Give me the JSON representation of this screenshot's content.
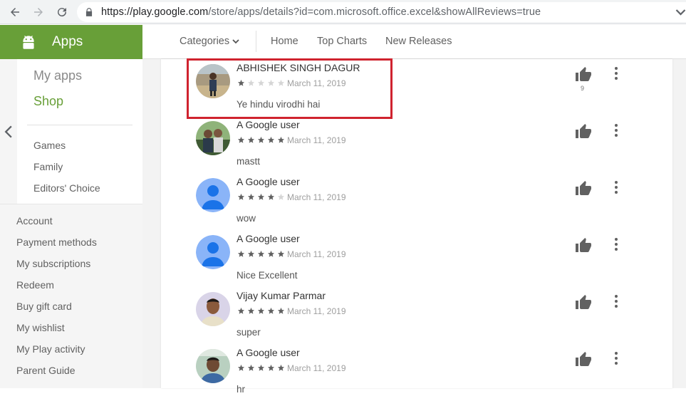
{
  "browser": {
    "url_host": "https://play.google.com",
    "url_path": "/store/apps/details?id=com.microsoft.office.excel&showAllReviews=true"
  },
  "sidebar": {
    "header": "Apps",
    "my_apps": "My apps",
    "shop": "Shop",
    "sub_items": [
      "Games",
      "Family",
      "Editors' Choice"
    ],
    "account_items": [
      "Account",
      "Payment methods",
      "My subscriptions",
      "Redeem",
      "Buy gift card",
      "My wishlist",
      "My Play activity",
      "Parent Guide"
    ]
  },
  "topnav": {
    "categories": "Categories",
    "home": "Home",
    "top_charts": "Top Charts",
    "new_releases": "New Releases"
  },
  "reviews": [
    {
      "author": "ABHISHEK SINGH DAGUR",
      "rating": 1,
      "date": "March 11, 2019",
      "text": "Ye hindu virodhi hai",
      "helpful": "9"
    },
    {
      "author": "A Google user",
      "rating": 5,
      "date": "March 11, 2019",
      "text": "mastt",
      "helpful": ""
    },
    {
      "author": "A Google user",
      "rating": 4,
      "date": "March 11, 2019",
      "text": "wow",
      "helpful": ""
    },
    {
      "author": "A Google user",
      "rating": 5,
      "date": "March 11, 2019",
      "text": "Nice Excellent",
      "helpful": ""
    },
    {
      "author": "Vijay Kumar Parmar",
      "rating": 5,
      "date": "March 11, 2019",
      "text": "super",
      "helpful": ""
    },
    {
      "author": "A Google user",
      "rating": 5,
      "date": "March 11, 2019",
      "text": "hr",
      "helpful": ""
    }
  ],
  "colors": {
    "brand_green": "#689f38",
    "highlight_red": "#d0232f",
    "star_filled": "#616161",
    "star_empty": "#d6d6d6"
  }
}
